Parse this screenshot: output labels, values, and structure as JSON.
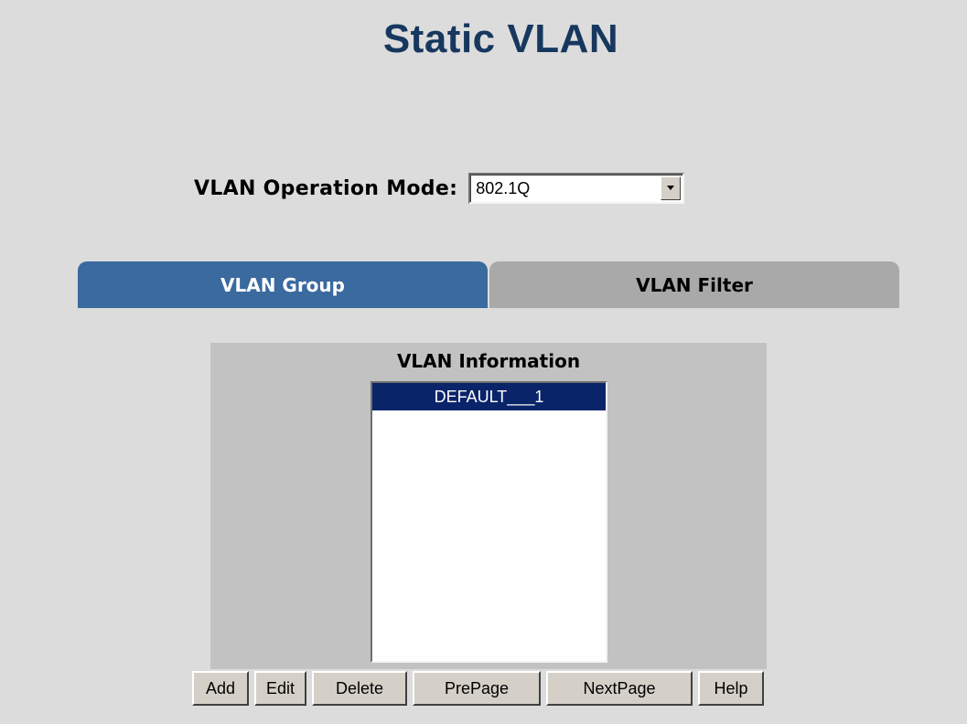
{
  "page": {
    "title": "Static VLAN"
  },
  "mode": {
    "label": "VLAN Operation Mode:",
    "selected": "802.1Q"
  },
  "tabs": [
    {
      "label": "VLAN Group",
      "active": true
    },
    {
      "label": "VLAN Filter",
      "active": false
    }
  ],
  "info": {
    "title": "VLAN Information",
    "items": [
      {
        "label": "DEFAULT___1",
        "selected": true
      }
    ]
  },
  "buttons": {
    "add": "Add",
    "edit": "Edit",
    "delete": "Delete",
    "prepage": "PrePage",
    "nextpage": "NextPage",
    "help": "Help"
  },
  "colors": {
    "title": "#17375e",
    "active_tab": "#3a6a9e",
    "inactive_tab": "#a9a9a9",
    "selection": "#0a246a",
    "background": "#dcdcdc",
    "panel": "#c2c2c2"
  },
  "icons": {
    "dropdown": "chevron-down-icon"
  }
}
